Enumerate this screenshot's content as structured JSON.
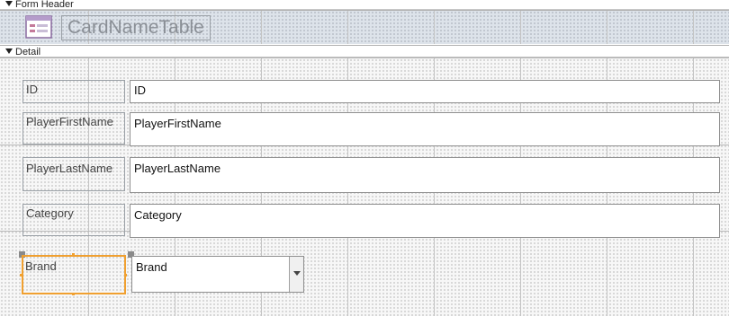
{
  "form_header_section": {
    "label": "Form Header"
  },
  "form_header": {
    "title": "CardNameTable",
    "icon": "form-icon"
  },
  "detail_section": {
    "label": "Detail"
  },
  "fields": [
    {
      "label": "ID",
      "control_value": "ID",
      "control_type": "textbox"
    },
    {
      "label": "PlayerFirstName",
      "control_value": "PlayerFirstName",
      "control_type": "textbox"
    },
    {
      "label": "PlayerLastName",
      "control_value": "PlayerLastName",
      "control_type": "textbox"
    },
    {
      "label": "Category",
      "control_value": "Category",
      "control_type": "textbox"
    },
    {
      "label": "Brand",
      "control_value": "Brand",
      "control_type": "combobox",
      "selected": true
    }
  ],
  "colors": {
    "selection": "#f0a030",
    "header_background": "#dde3ea",
    "grid_line": "#c4c4c4"
  }
}
